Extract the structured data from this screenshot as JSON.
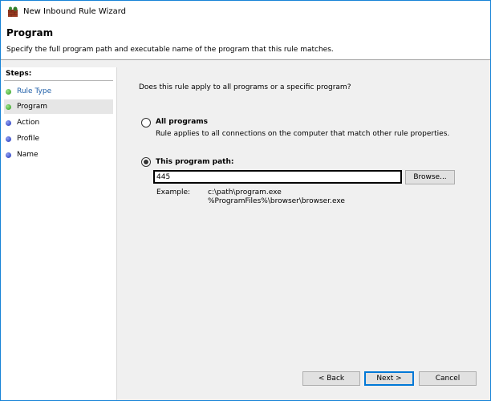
{
  "window": {
    "title": "New Inbound Rule Wizard",
    "accent_color": "#1883d7",
    "icon": "firewall-icon"
  },
  "header": {
    "title": "Program",
    "description": "Specify the full program path and executable name of the program that this rule matches."
  },
  "steps": {
    "title": "Steps:",
    "items": [
      {
        "label": "Rule Type",
        "state": "done",
        "style": "link"
      },
      {
        "label": "Program",
        "state": "done",
        "style": "current"
      },
      {
        "label": "Action",
        "state": "todo",
        "style": "normal"
      },
      {
        "label": "Profile",
        "state": "todo",
        "style": "normal"
      },
      {
        "label": "Name",
        "state": "todo",
        "style": "normal"
      }
    ]
  },
  "main": {
    "question": "Does this rule apply to all programs or a specific program?",
    "options": [
      {
        "label": "All programs",
        "description": "Rule applies to all connections on the computer that match other rule properties.",
        "selected": false
      },
      {
        "label": "This program path:",
        "selected": true
      }
    ],
    "path_value": "445",
    "browse_label": "Browse...",
    "example_label": "Example:",
    "example_lines": [
      "c:\\path\\program.exe",
      "%ProgramFiles%\\browser\\browser.exe"
    ]
  },
  "footer": {
    "back_label": "< Back",
    "next_label": "Next >",
    "cancel_label": "Cancel"
  }
}
